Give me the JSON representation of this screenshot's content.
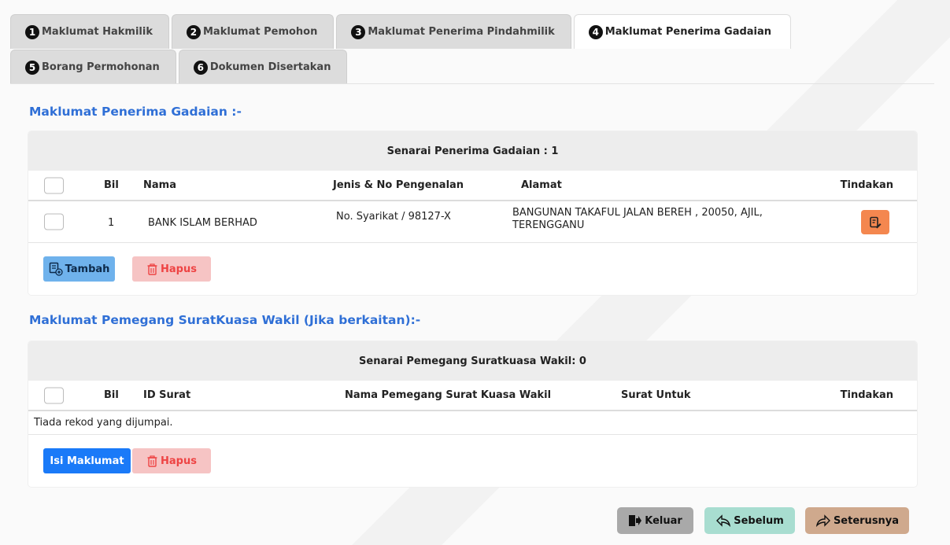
{
  "tabs": [
    {
      "num": "1",
      "label": "Maklumat Hakmilik"
    },
    {
      "num": "2",
      "label": "Maklumat Pemohon"
    },
    {
      "num": "3",
      "label": "Maklumat Penerima Pindahmilik"
    },
    {
      "num": "4",
      "label": "Maklumat Penerima Gadaian"
    },
    {
      "num": "5",
      "label": "Borang Permohonan"
    },
    {
      "num": "6",
      "label": "Dokumen Disertakan"
    }
  ],
  "active_tab": "4",
  "section1": {
    "title": "Maklumat Penerima Gadaian :-",
    "header": "Senarai Penerima Gadaian : 1",
    "columns": [
      "Bil",
      "Nama",
      "Jenis & No Pengenalan",
      "Alamat",
      "Tindakan"
    ],
    "rows": [
      {
        "bil": "1",
        "nama": "BANK ISLAM BERHAD",
        "jenis": "No. Syarikat / 98127-X",
        "alamat": "BANGUNAN TAKAFUL JALAN BEREH , 20050, AJIL, TERENGGANU"
      }
    ],
    "tambah_label": "Tambah",
    "hapus_label": "Hapus"
  },
  "section2": {
    "title": "Maklumat Pemegang SuratKuasa Wakil (Jika berkaitan):-",
    "header": "Senarai Pemegang Suratkuasa Wakil: 0",
    "columns": [
      "Bil",
      "ID Surat",
      "Nama Pemegang Surat Kuasa Wakil",
      "Surat Untuk",
      "Tindakan"
    ],
    "empty_text": "Tiada rekod yang dijumpai.",
    "isi_label": "Isi Maklumat",
    "hapus_label": "Hapus"
  },
  "nav": {
    "keluar": "Keluar",
    "sebelum": "Sebelum",
    "seterusnya": "Seterusnya"
  },
  "colors": {
    "accent": "#2f6fd6",
    "tambah": "#6fb2ec",
    "hapus": "#f6c4c4",
    "isi": "#1a7af8",
    "edit": "#f4874f",
    "keluar": "#a9a9a9",
    "sebelum": "#a8ddd0",
    "seterusnya": "#cfa98d"
  }
}
